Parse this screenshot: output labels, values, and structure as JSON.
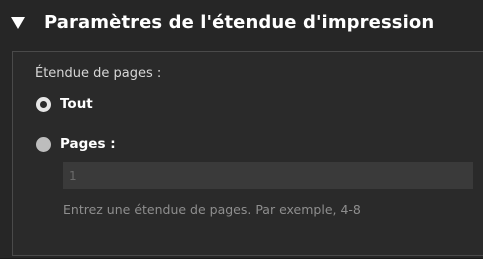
{
  "section": {
    "title": "Paramètres de l'étendue d'impression",
    "expanded_icon": "disclosure-triangle-down-icon"
  },
  "range": {
    "label": "Étendue de pages :",
    "options": [
      {
        "label": "Tout",
        "selected": true
      },
      {
        "label": "Pages :",
        "selected": false
      }
    ],
    "pages_input_value": "1",
    "hint": "Entrez une étendue de pages. Par exemple, 4-8"
  },
  "colors": {
    "panel_background": "#262626",
    "title_text": "#ffffff",
    "hint_text": "#8e8e8e"
  }
}
